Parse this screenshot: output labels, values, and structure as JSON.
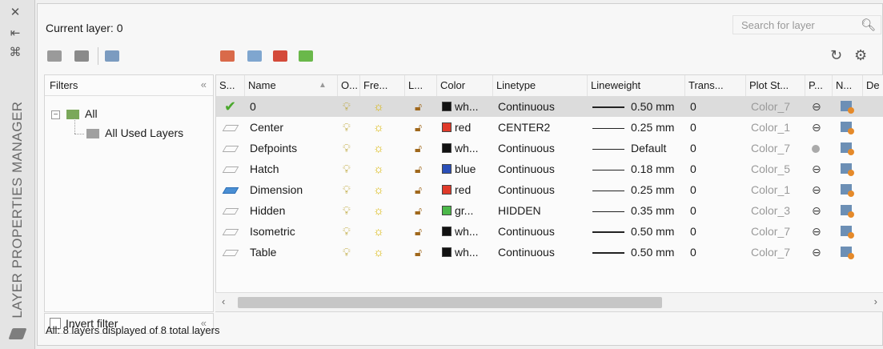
{
  "panel_title": "LAYER PROPERTIES MANAGER",
  "current_layer": "Current layer: 0",
  "search_placeholder": "Search for layer",
  "filters": {
    "header": "Filters",
    "tree": [
      {
        "label": "All"
      },
      {
        "label": "All Used Layers"
      }
    ],
    "invert_label": "Invert filter",
    "invert_checked": false
  },
  "columns": [
    "S...",
    "Name",
    "O...",
    "Fre...",
    "L...",
    "Color",
    "Linetype",
    "Lineweight",
    "Trans...",
    "Plot St...",
    "P...",
    "N...",
    "De"
  ],
  "layers": [
    {
      "name": "0",
      "status": "current",
      "color_name": "wh...",
      "color_hex": "#111111",
      "linetype": "Continuous",
      "lineweight": "0.50 mm",
      "thick": true,
      "trans": "0",
      "plot_style": "Color_7",
      "plot": "printer"
    },
    {
      "name": "Center",
      "status": "normal",
      "color_name": "red",
      "color_hex": "#e03a2a",
      "linetype": "CENTER2",
      "lineweight": "0.25 mm",
      "thick": false,
      "trans": "0",
      "plot_style": "Color_1",
      "plot": "printer"
    },
    {
      "name": "Defpoints",
      "status": "normal",
      "color_name": "wh...",
      "color_hex": "#111111",
      "linetype": "Continuous",
      "lineweight": "Default",
      "thick": false,
      "trans": "0",
      "plot_style": "Color_7",
      "plot": "noplot"
    },
    {
      "name": "Hatch",
      "status": "normal",
      "color_name": "blue",
      "color_hex": "#2a4fb8",
      "linetype": "Continuous",
      "lineweight": "0.18 mm",
      "thick": false,
      "trans": "0",
      "plot_style": "Color_5",
      "plot": "printer"
    },
    {
      "name": "Dimension",
      "status": "blue",
      "color_name": "red",
      "color_hex": "#e03a2a",
      "linetype": "Continuous",
      "lineweight": "0.25 mm",
      "thick": false,
      "trans": "0",
      "plot_style": "Color_1",
      "plot": "printer"
    },
    {
      "name": "Hidden",
      "status": "normal",
      "color_name": "gr...",
      "color_hex": "#4cb84a",
      "linetype": "HIDDEN",
      "lineweight": "0.35 mm",
      "thick": false,
      "trans": "0",
      "plot_style": "Color_3",
      "plot": "printer"
    },
    {
      "name": "Isometric",
      "status": "normal",
      "color_name": "wh...",
      "color_hex": "#111111",
      "linetype": "Continuous",
      "lineweight": "0.50 mm",
      "thick": true,
      "trans": "0",
      "plot_style": "Color_7",
      "plot": "printer"
    },
    {
      "name": "Table",
      "status": "normal",
      "color_name": "wh...",
      "color_hex": "#111111",
      "linetype": "Continuous",
      "lineweight": "0.50 mm",
      "thick": true,
      "trans": "0",
      "plot_style": "Color_7",
      "plot": "printer"
    }
  ],
  "status_text": "All: 8 layers displayed of 8 total layers",
  "icons": {
    "close": "close-icon",
    "auto_hide": "auto-hide-icon",
    "properties": "properties-icon",
    "refresh": "refresh-icon",
    "settings": "settings-icon"
  }
}
